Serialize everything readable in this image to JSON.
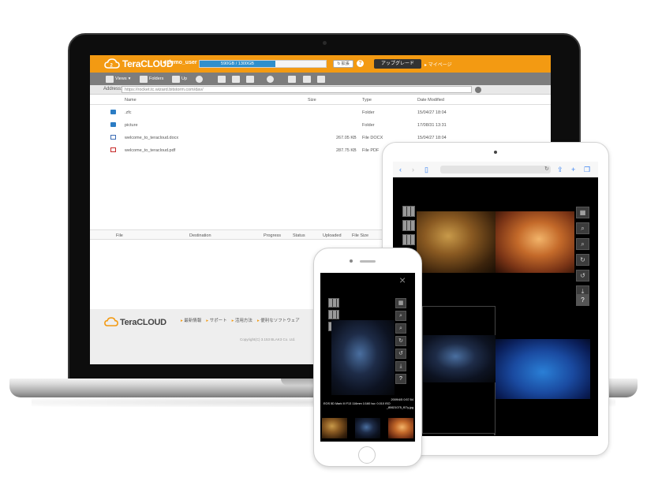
{
  "app": {
    "logo_text": "TeraCLOUD",
    "user_name": "demo_user",
    "quota_text": "590GB / 1300GB",
    "quota_fraction": 0.6,
    "expand_label": "拡張",
    "help_label": "?",
    "upgrade_label": "アップグレード",
    "mypage_label": "マイページ"
  },
  "toolbar": {
    "views_label": "Views",
    "folders_label": "Folders",
    "up_label": "Up"
  },
  "address": {
    "label": "Address:",
    "value": "https://rocket.tc.wizard.bitstorm.com/dav/"
  },
  "file_table": {
    "columns": [
      "Name",
      "Size",
      "Type",
      "Date Modified"
    ],
    "rows": [
      {
        "name": ".zfc",
        "size": "",
        "type": "Folder",
        "date": "15/04/27 18:04",
        "icon": "folder-icon"
      },
      {
        "name": "picture",
        "size": "",
        "type": "Folder",
        "date": "17/08/31 13:31",
        "icon": "folder-icon"
      },
      {
        "name": "welcome_to_teracloud.docx",
        "size": "267.05 KB",
        "type": "File DOCX",
        "date": "15/04/27 18:04",
        "icon": "docx-file-icon"
      },
      {
        "name": "welcome_to_teracloud.pdf",
        "size": "287.75 KB",
        "type": "File PDF",
        "date": "",
        "icon": "pdf-file-icon"
      }
    ]
  },
  "transfer_table": {
    "columns": [
      "File",
      "Destination",
      "Progress",
      "Status",
      "Uploaded",
      "File Size"
    ]
  },
  "footer": {
    "logo_text": "TeraCLOUD",
    "links": [
      "最新情報",
      "サポート",
      "活用方法",
      "便利なソフトウェア"
    ],
    "copyright": "Copyright(C) 3.153 BLAK3 Co. Ltd."
  },
  "phone_exif": {
    "line1": "2009/4/5 0:57:54",
    "line2": "EOS 5D Mark III F13 116mm 1/160 Iso: 0.010 ISO",
    "line3": "_80621075_f07y.jpg"
  },
  "colors": {
    "brand_orange": "#f39a12",
    "toolbar_gray": "#7d7d7d",
    "quota_blue": "#2f8fcc"
  }
}
